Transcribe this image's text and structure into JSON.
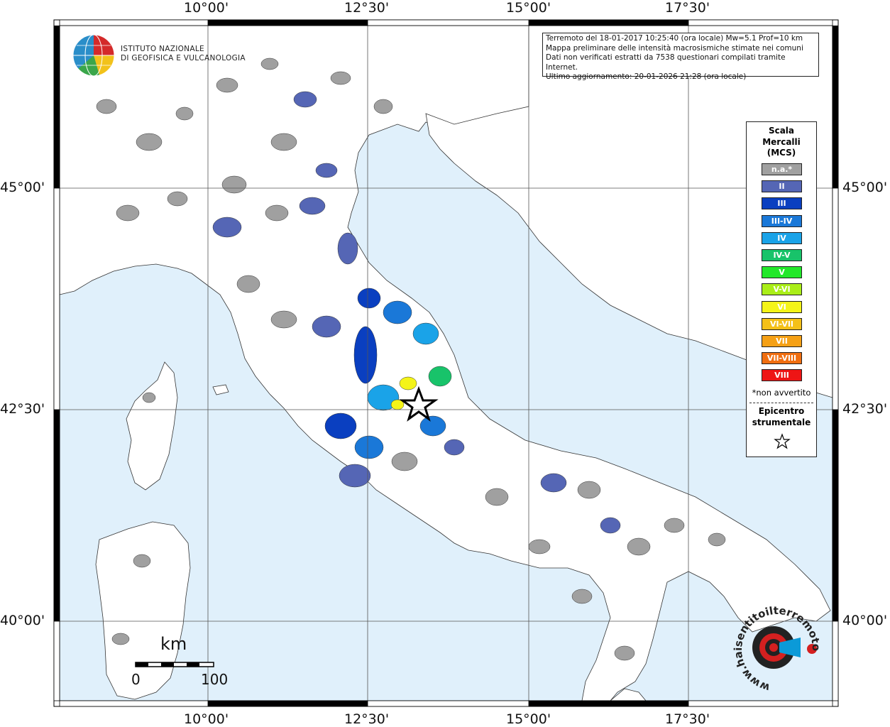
{
  "axes": {
    "lon_labels": [
      "10°00'",
      "12°30'",
      "15°00'",
      "17°30'"
    ],
    "lat_labels": [
      "45°00'",
      "42°30'",
      "40°00'"
    ]
  },
  "info": {
    "line1": "Terremoto del 18-01-2017 10:25:40 (ora locale) Mw=5.1 Prof=10 km",
    "line2": "Mappa preliminare delle intensità macrosismiche stimate nei comuni",
    "line3": "Dati non verificati estratti da 7538 questionari compilati tramite Internet.",
    "line4": "Ultimo aggiornamento: 20-01-2026 21:28 (ora locale)"
  },
  "logo": {
    "line1": "ISTITUTO NAZIONALE",
    "line2": "DI GEOFISICA E VULCANOLOGIA",
    "ring_text": "haisentitoilterremoto.it",
    "ring_url": "www."
  },
  "legend": {
    "title1": "Scala",
    "title2": "Mercalli",
    "title3": "(MCS)",
    "classes": [
      {
        "label": "n.a.*",
        "color": "#a0a0a0"
      },
      {
        "label": "II",
        "color": "#5566b5"
      },
      {
        "label": "III",
        "color": "#0a3fc0"
      },
      {
        "label": "III-IV",
        "color": "#1a78d8"
      },
      {
        "label": "IV",
        "color": "#1aa3e8"
      },
      {
        "label": "IV-V",
        "color": "#18c36a"
      },
      {
        "label": "V",
        "color": "#22e82a"
      },
      {
        "label": "V-VI",
        "color": "#aaee18"
      },
      {
        "label": "VI",
        "color": "#f4f418"
      },
      {
        "label": "VI-VII",
        "color": "#f4c018"
      },
      {
        "label": "VII",
        "color": "#f5a015"
      },
      {
        "label": "VII-VIII",
        "color": "#f06e10"
      },
      {
        "label": "VIII",
        "color": "#ee1515"
      }
    ],
    "note": "*non avvertito",
    "epi1": "Epicentro",
    "epi2": "strumentale"
  },
  "scale": {
    "unit": "km",
    "min": "0",
    "max": "100"
  },
  "colors": {
    "sea": "#e0f0fb",
    "land": "#ffffff",
    "frame": "#000000"
  }
}
